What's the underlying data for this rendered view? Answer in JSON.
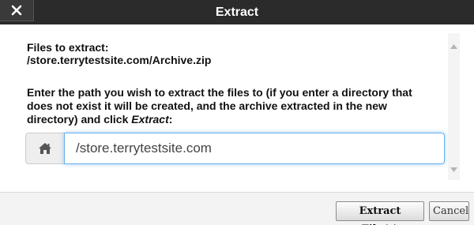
{
  "dialog": {
    "title": "Extract",
    "files_label": "Files to extract:",
    "files_path": "/store.terrytestsite.com/Archive.zip",
    "instructions_prefix": "Enter the path you wish to extract the files to (if you enter a directory that does not exist it will be created, and the archive extracted in the new directory) and click ",
    "instructions_action": "Extract",
    "instructions_suffix": ":",
    "path_input": {
      "value": "/store.terrytestsite.com",
      "icon": "home-icon"
    },
    "buttons": {
      "extract_label": "Extract File(s)",
      "cancel_label": "Cancel"
    }
  },
  "colors": {
    "titlebar": "#2b2b2b",
    "input_focus": "#66afe9",
    "footer": "#f3f3f3"
  }
}
